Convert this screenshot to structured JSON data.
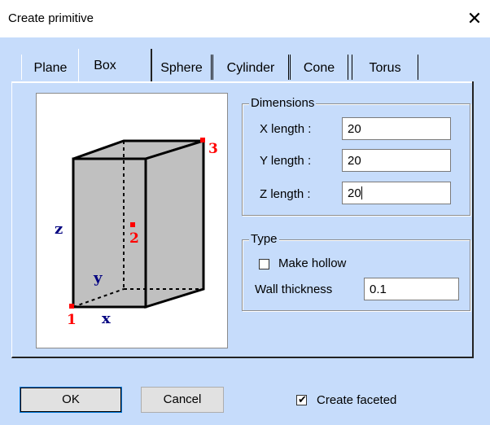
{
  "window": {
    "title": "Create primitive",
    "close_icon": "close-icon"
  },
  "tabs": [
    {
      "label": "Plane",
      "active": false
    },
    {
      "label": "Box",
      "active": true
    },
    {
      "label": "Sphere",
      "active": false
    },
    {
      "label": "Cylinder",
      "active": false
    },
    {
      "label": "Cone",
      "active": false
    },
    {
      "label": "Torus",
      "active": false
    }
  ],
  "illustration": {
    "axis_x": "x",
    "axis_y": "y",
    "axis_z": "z",
    "point_1": "1",
    "point_2": "2",
    "point_3": "3",
    "label_color": "#000080",
    "point_color": "#ff0000"
  },
  "dimensions": {
    "legend": "Dimensions",
    "x_label": "X length :",
    "x_value": "20",
    "y_label": "Y length :",
    "y_value": "20",
    "z_label": "Z length :",
    "z_value": "20"
  },
  "type": {
    "legend": "Type",
    "hollow_label": "Make hollow",
    "hollow_checked": false,
    "wall_label": "Wall thickness",
    "wall_value": "0.1"
  },
  "footer": {
    "ok_label": "OK",
    "cancel_label": "Cancel",
    "faceted_label": "Create faceted",
    "faceted_checked": true
  }
}
